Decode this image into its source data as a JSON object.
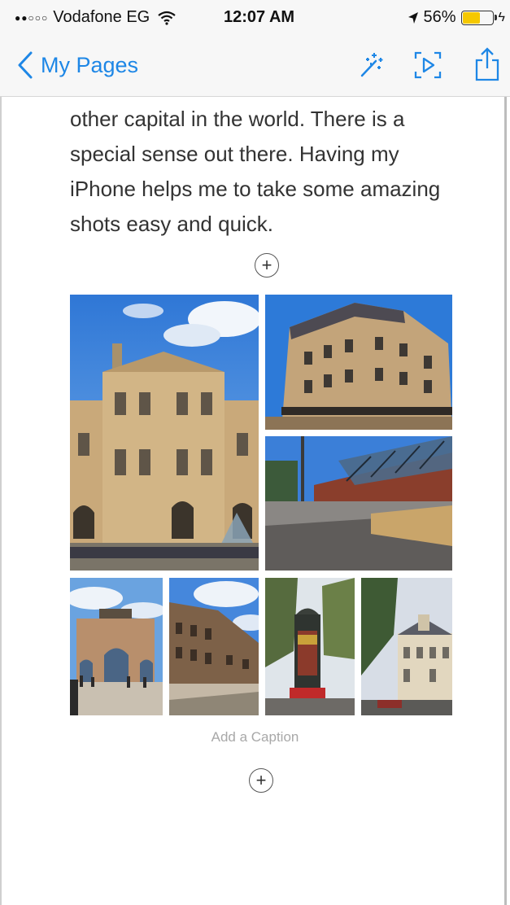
{
  "status_bar": {
    "signal": "●●○○○",
    "carrier": "Vodafone EG",
    "time": "12:07 AM",
    "battery": "56%",
    "battery_level": 0.56
  },
  "nav": {
    "back_label": "My Pages",
    "icons": [
      "magic-wand-icon",
      "play-preview-icon",
      "share-icon"
    ]
  },
  "story": {
    "paragraph": "other capital in the world. There is a\nspecial sense out there. Having my\niPhone helps me to take some amazing\nshots easy and quick."
  },
  "photos": [
    {
      "name": "photo-louvre",
      "subject": "Louvre palace"
    },
    {
      "name": "photo-haussmann-building",
      "subject": "Parisian apartment building"
    },
    {
      "name": "photo-street-square",
      "subject": "Street with glass canopy"
    },
    {
      "name": "photo-arc-carrousel",
      "subject": "Arc de Triomphe du Carrousel"
    },
    {
      "name": "photo-stone-building",
      "subject": "Stone building"
    },
    {
      "name": "photo-morris-column",
      "subject": "Morris advertising column"
    },
    {
      "name": "photo-town-hall",
      "subject": "Town hall building"
    }
  ],
  "add_icon": "+",
  "caption_placeholder": "Add a Caption",
  "colors": {
    "accent": "#1e87e6",
    "sky": "#3f86e0",
    "stone": "#c9a97a"
  }
}
